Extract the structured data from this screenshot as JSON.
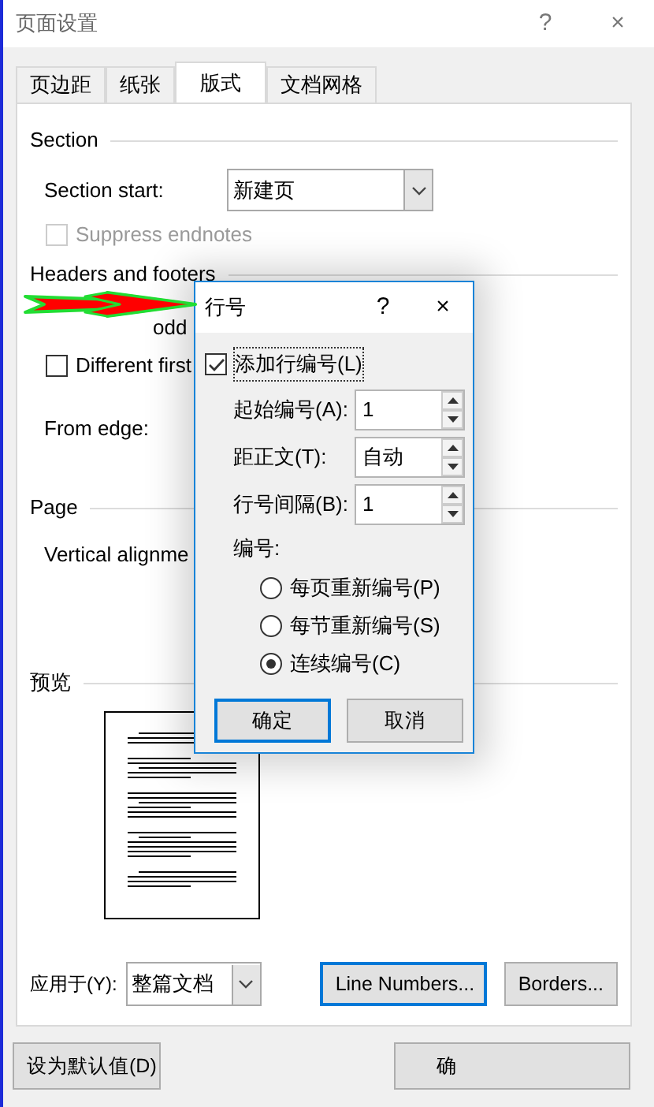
{
  "window": {
    "title": "页面设置",
    "help": "?",
    "close": "×"
  },
  "tabs": [
    {
      "label": "页边距",
      "selected": false
    },
    {
      "label": "纸张",
      "selected": false
    },
    {
      "label": "版式",
      "selected": true
    },
    {
      "label": "文档网格",
      "selected": false
    }
  ],
  "section": {
    "heading": "Section",
    "start_label": "Section start:",
    "start_value": "新建页",
    "suppress": {
      "label": "Suppress endnotes",
      "checked": false,
      "disabled": true
    }
  },
  "headers_footers": {
    "heading": "Headers and footers",
    "options": [
      {
        "label": "odd"
      },
      {
        "label": "Different first",
        "checked": false
      }
    ],
    "from_edge_label": "From edge:"
  },
  "page": {
    "heading": "Page",
    "vertical_label": "Vertical alignme"
  },
  "preview": {
    "heading": "预览"
  },
  "apply": {
    "label": "应用于(Y):",
    "value": "整篇文档"
  },
  "panel_buttons": [
    {
      "label": "Line Numbers...",
      "focused": true
    },
    {
      "label": "Borders...",
      "focused": false
    }
  ],
  "footer_buttons": [
    {
      "label": "设为默认值(D)",
      "focused": false
    },
    {
      "label": "确",
      "focused": false
    }
  ],
  "line_numbers_dialog": {
    "title": "行号",
    "help": "?",
    "close": "×",
    "add": {
      "label": "添加行编号(L)",
      "checked": true
    },
    "fields": [
      {
        "label": "起始编号(A):",
        "value": "1"
      },
      {
        "label": "距正文(T):",
        "value": "自动"
      },
      {
        "label": "行号间隔(B):",
        "value": "1"
      }
    ],
    "numbering_label": "编号:",
    "options": [
      {
        "label": "每页重新编号(P)",
        "selected": false
      },
      {
        "label": "每节重新编号(S)",
        "selected": false
      },
      {
        "label": "连续编号(C)",
        "selected": true
      }
    ],
    "buttons": [
      {
        "label": "确定",
        "focused": true
      },
      {
        "label": "取消",
        "focused": false
      }
    ]
  }
}
